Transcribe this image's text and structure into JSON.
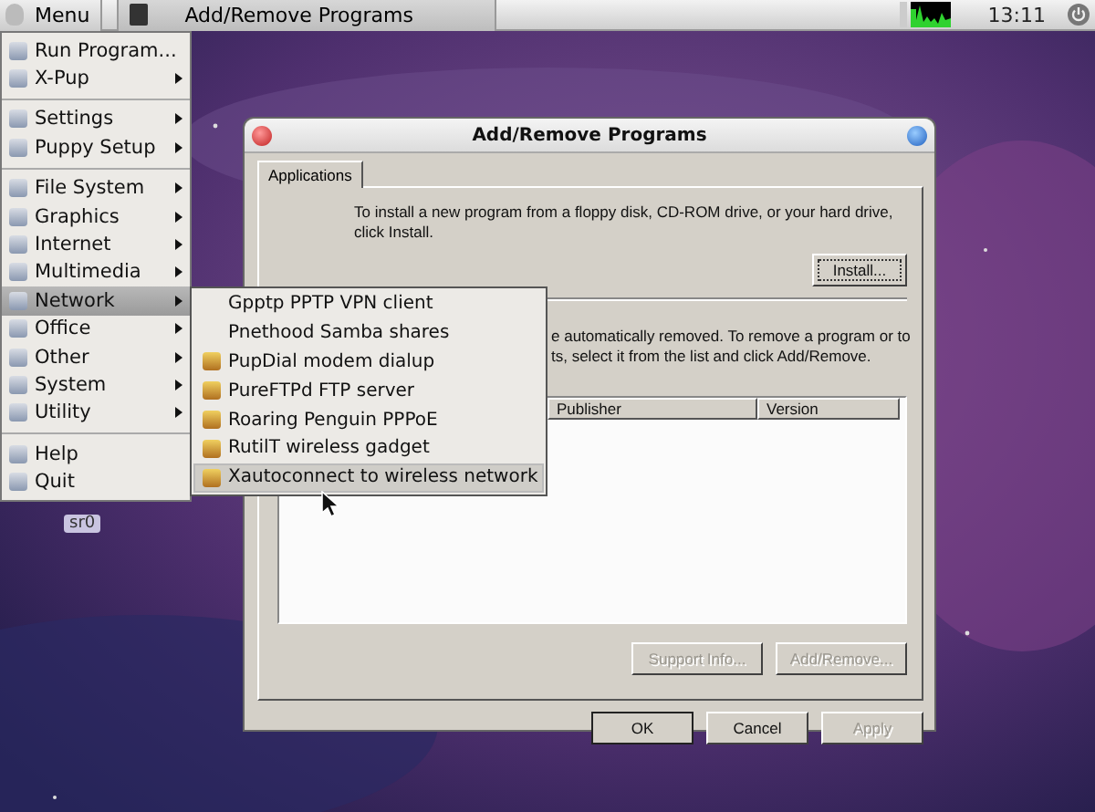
{
  "taskbar": {
    "menu_button": "Menu",
    "tasks": [
      {
        "label": "Add/Remove Programs",
        "selected": true
      }
    ],
    "clock": "13:11"
  },
  "desktop": {
    "icons": [
      {
        "label": "sr0"
      }
    ]
  },
  "main_menu": {
    "items": [
      {
        "label": "Run Program...",
        "has_submenu": false,
        "selected": false,
        "separator_after": false
      },
      {
        "label": "X-Pup",
        "has_submenu": true,
        "selected": false,
        "separator_after": true
      },
      {
        "label": "Settings",
        "has_submenu": true,
        "selected": false,
        "separator_after": false
      },
      {
        "label": "Puppy Setup",
        "has_submenu": true,
        "selected": false,
        "separator_after": true
      },
      {
        "label": "File System",
        "has_submenu": true,
        "selected": false,
        "separator_after": false
      },
      {
        "label": "Graphics",
        "has_submenu": true,
        "selected": false,
        "separator_after": false
      },
      {
        "label": "Internet",
        "has_submenu": true,
        "selected": false,
        "separator_after": false
      },
      {
        "label": "Multimedia",
        "has_submenu": true,
        "selected": false,
        "separator_after": false
      },
      {
        "label": "Network",
        "has_submenu": true,
        "selected": true,
        "separator_after": false
      },
      {
        "label": "Office",
        "has_submenu": true,
        "selected": false,
        "separator_after": false
      },
      {
        "label": "Other",
        "has_submenu": true,
        "selected": false,
        "separator_after": false
      },
      {
        "label": "System",
        "has_submenu": true,
        "selected": false,
        "separator_after": false
      },
      {
        "label": "Utility",
        "has_submenu": true,
        "selected": false,
        "separator_after": true
      },
      {
        "label": "Help",
        "has_submenu": false,
        "selected": false,
        "separator_after": false
      },
      {
        "label": "Quit",
        "has_submenu": false,
        "selected": false,
        "separator_after": false
      }
    ]
  },
  "network_submenu": {
    "items": [
      {
        "label": "Gpptp PPTP VPN client",
        "has_icon": false,
        "selected": false
      },
      {
        "label": "Pnethood Samba shares",
        "has_icon": false,
        "selected": false
      },
      {
        "label": "PupDial modem dialup",
        "has_icon": true,
        "selected": false
      },
      {
        "label": "PureFTPd FTP server",
        "has_icon": true,
        "selected": false
      },
      {
        "label": "Roaring Penguin PPPoE",
        "has_icon": true,
        "selected": false
      },
      {
        "label": "RutilT wireless gadget",
        "has_icon": true,
        "selected": false
      },
      {
        "label": "Xautoconnect to wireless network",
        "has_icon": true,
        "selected": true
      }
    ]
  },
  "dialog": {
    "title": "Add/Remove Programs",
    "tabs": [
      {
        "label": "Applications",
        "selected": true
      }
    ],
    "install_text": "To install a new program from a floppy disk, CD-ROM drive, or your hard drive, click Install.",
    "install_button": {
      "label": "Install...",
      "disabled": false
    },
    "remove_text_lines": [
      "e automatically removed. To remove a program or to",
      "ts, select it from the list and click Add/Remove."
    ],
    "table": {
      "columns": [
        "Publisher",
        "Version"
      ]
    },
    "list_buttons": [
      {
        "label": "Support Info...",
        "disabled": true
      },
      {
        "label": "Add/Remove...",
        "disabled": true
      }
    ],
    "buttons": [
      {
        "label": "OK",
        "disabled": false,
        "default": true
      },
      {
        "label": "Cancel",
        "disabled": false,
        "default": false
      },
      {
        "label": "Apply",
        "disabled": true,
        "default": false
      }
    ]
  }
}
